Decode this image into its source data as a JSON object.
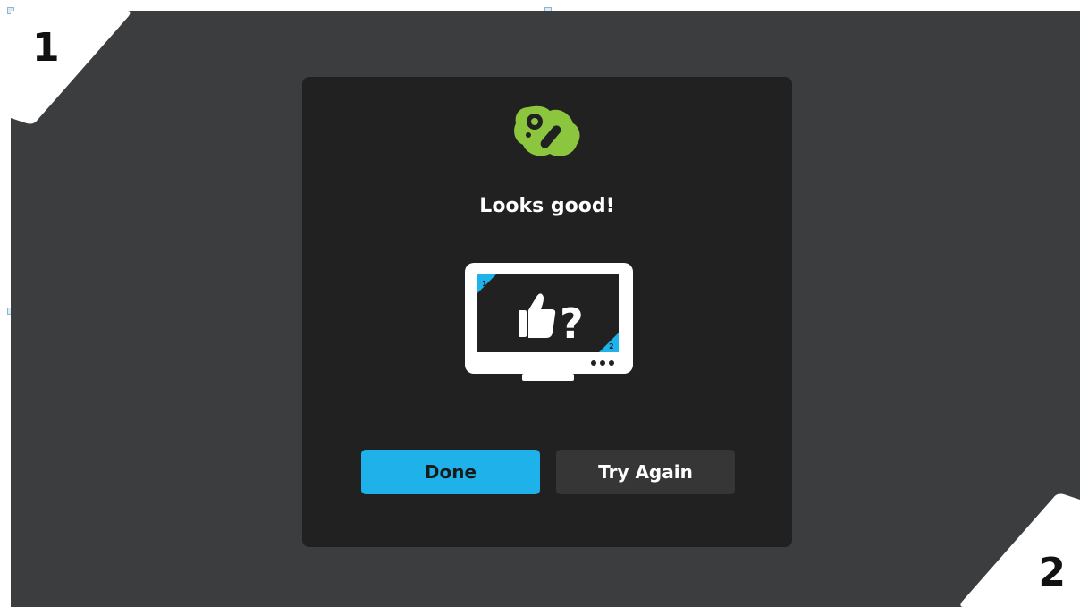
{
  "corners": {
    "top_left_number": "1",
    "bottom_right_number": "2"
  },
  "dialog": {
    "logo_icon": "boxee-logo-icon",
    "title": "Looks good!",
    "illustration_icon": "tv-thumbs-up-question-icon",
    "illustration_text": "?",
    "illustration_corner_labels": [
      "1",
      "2"
    ],
    "buttons": {
      "done_label": "Done",
      "try_again_label": "Try Again"
    }
  },
  "colors": {
    "screen_background": "#3b3d3f",
    "dialog_background": "#212121",
    "accent": "#1fb2ea",
    "logo_green": "#8cc63f",
    "secondary_button": "#363636"
  }
}
